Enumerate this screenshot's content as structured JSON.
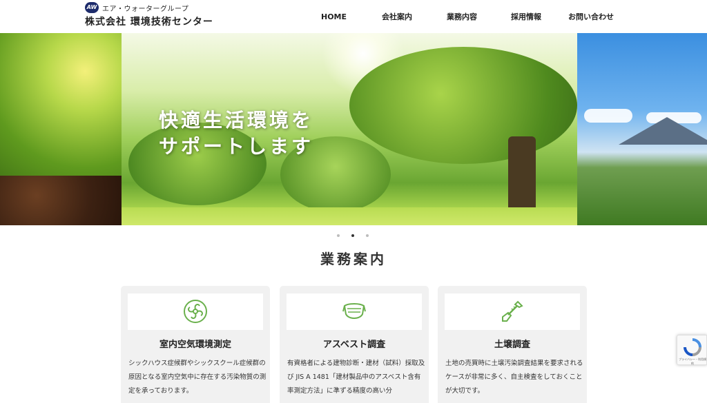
{
  "header": {
    "group_name": "エア・ウォーターグループ",
    "logo_mark": "AW",
    "company_name": "株式会社 環境技術センター"
  },
  "nav": {
    "items": [
      "HOME",
      "会社案内",
      "業務内容",
      "採用情報",
      "お問い合わせ"
    ]
  },
  "hero": {
    "line1": "快適生活環境を",
    "line2": "サポートします"
  },
  "slider": {
    "count": 3,
    "active": 2
  },
  "section": {
    "title": "業務案内"
  },
  "cards": [
    {
      "icon": "fan-icon",
      "title": "室内空気環境測定",
      "desc": "シックハウス症候群やシックスクール症候群の原因となる室内空気中に存在する汚染物質の測定を承っております。"
    },
    {
      "icon": "mask-icon",
      "title": "アスベスト調査",
      "desc": "有資格者による建物診断・建材（試料）採取及び JIS A 1481「建材製品中のアスベスト含有率測定方法」に準ずる精度の高い分"
    },
    {
      "icon": "shovel-icon",
      "title": "土壌調査",
      "desc": "土地の売買時に土壌汚染調査結果を要求されるケースが非常に多く、自主検査をしておくことが大切です。"
    }
  ],
  "colors": {
    "accent_green": "#6ab04c",
    "nav_text": "#222222",
    "card_bg": "#f1f1f1"
  },
  "recaptcha": {
    "text": "プライバシー・利用規約"
  }
}
